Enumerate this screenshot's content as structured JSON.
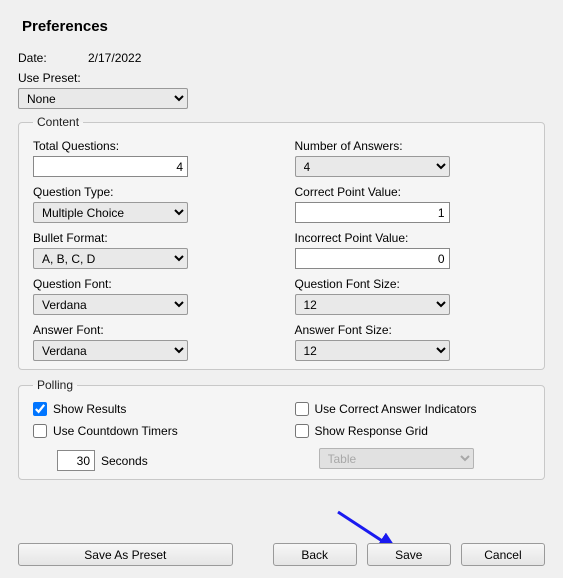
{
  "title": "Preferences",
  "date": {
    "label": "Date:",
    "value": "2/17/2022"
  },
  "use_preset": {
    "label": "Use Preset:",
    "selected": "None"
  },
  "content": {
    "legend": "Content",
    "total_questions": {
      "label": "Total Questions:",
      "value": "4"
    },
    "number_of_answers": {
      "label": "Number of Answers:",
      "selected": "4"
    },
    "question_type": {
      "label": "Question Type:",
      "selected": "Multiple Choice"
    },
    "correct_point_value": {
      "label": "Correct Point Value:",
      "value": "1"
    },
    "bullet_format": {
      "label": "Bullet Format:",
      "selected": "A, B, C, D"
    },
    "incorrect_point_value": {
      "label": "Incorrect Point Value:",
      "value": "0"
    },
    "question_font": {
      "label": "Question Font:",
      "selected": "Verdana"
    },
    "question_font_size": {
      "label": "Question Font Size:",
      "selected": "12"
    },
    "answer_font": {
      "label": "Answer Font:",
      "selected": "Verdana"
    },
    "answer_font_size": {
      "label": "Answer Font Size:",
      "selected": "12"
    }
  },
  "polling": {
    "legend": "Polling",
    "show_results": {
      "label": "Show Results",
      "checked": true
    },
    "use_correct_answer_indicators": {
      "label": "Use Correct Answer Indicators",
      "checked": false
    },
    "use_countdown_timers": {
      "label": "Use Countdown Timers",
      "checked": false
    },
    "show_response_grid": {
      "label": "Show Response Grid",
      "checked": false
    },
    "seconds": {
      "value": "30",
      "label": "Seconds"
    },
    "chart_type": {
      "selected": "Table"
    }
  },
  "buttons": {
    "save_as_preset": "Save As Preset",
    "back": "Back",
    "save": "Save",
    "cancel": "Cancel"
  }
}
